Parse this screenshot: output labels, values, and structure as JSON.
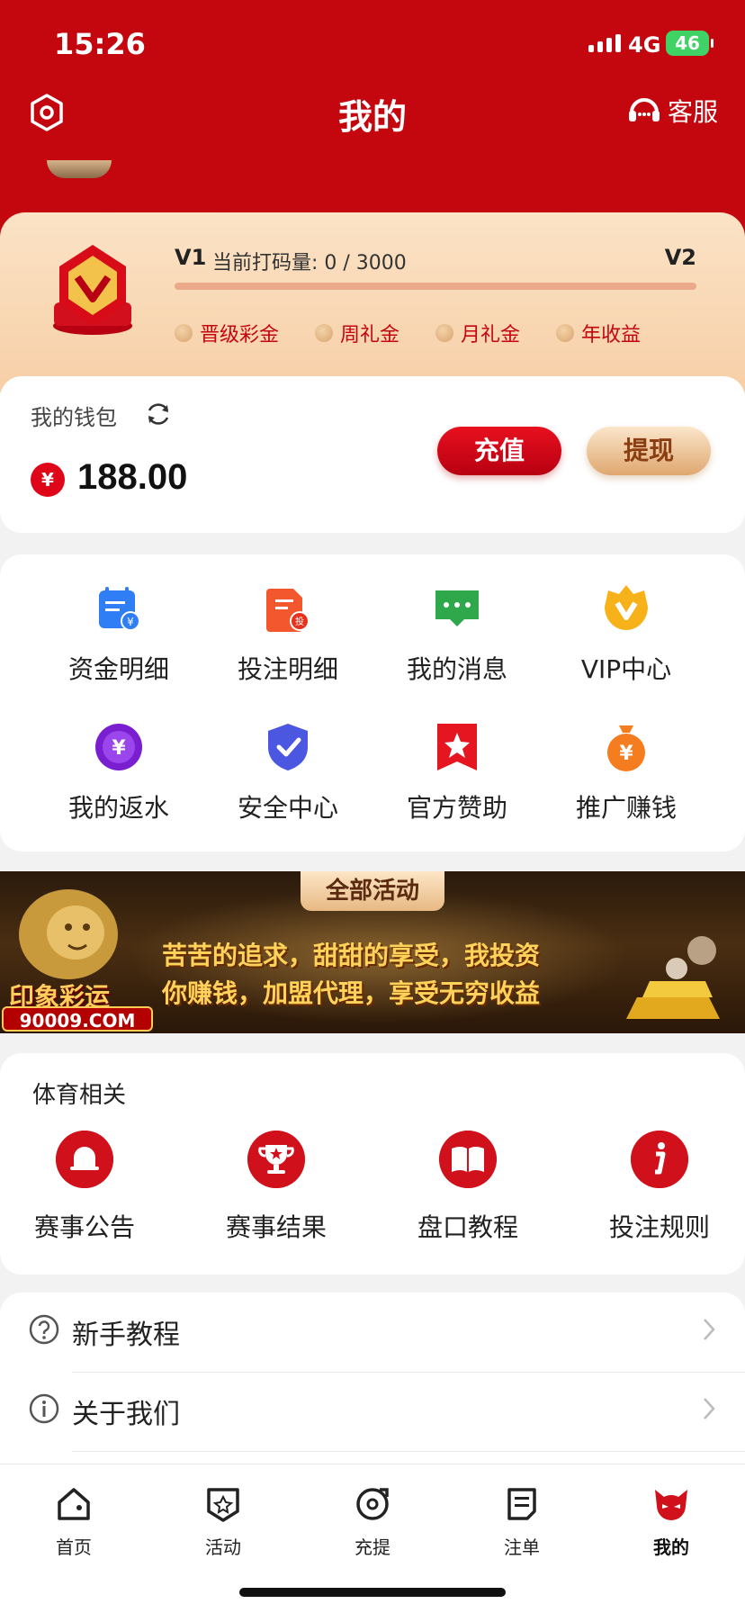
{
  "status": {
    "time": "15:26",
    "network": "4G",
    "battery": "46"
  },
  "header": {
    "title": "我的",
    "service_label": "客服"
  },
  "vip": {
    "current_level": "V1",
    "progress_label": "当前打码量: 0 / 3000",
    "progress_value": 0,
    "progress_target": 3000,
    "next_level": "V2",
    "perks": [
      "晋级彩金",
      "周礼金",
      "月礼金",
      "年收益"
    ]
  },
  "wallet": {
    "label": "我的钱包",
    "currency_symbol": "¥",
    "balance": "188.00",
    "deposit_label": "充值",
    "withdraw_label": "提现"
  },
  "menu": {
    "items": [
      {
        "label": "资金明细",
        "icon": "fund-detail-icon"
      },
      {
        "label": "投注明细",
        "icon": "bet-detail-icon"
      },
      {
        "label": "我的消息",
        "icon": "message-icon"
      },
      {
        "label": "VIP中心",
        "icon": "vip-crown-icon"
      },
      {
        "label": "我的返水",
        "icon": "rebate-icon"
      },
      {
        "label": "安全中心",
        "icon": "shield-check-icon"
      },
      {
        "label": "官方赞助",
        "icon": "star-ribbon-icon"
      },
      {
        "label": "推广赚钱",
        "icon": "promo-money-icon"
      }
    ]
  },
  "banner": {
    "tag": "全部活动",
    "line1": "苦苦的追求，甜甜的享受，我投资",
    "line2": "你赚钱，加盟代理，享受无穷收益",
    "brand": "印象彩运",
    "site": "90009.COM"
  },
  "sports": {
    "title": "体育相关",
    "items": [
      {
        "label": "赛事公告",
        "icon": "bell-icon"
      },
      {
        "label": "赛事结果",
        "icon": "trophy-icon"
      },
      {
        "label": "盘口教程",
        "icon": "book-icon"
      },
      {
        "label": "投注规则",
        "icon": "info-icon"
      }
    ]
  },
  "list": {
    "items": [
      {
        "label": "新手教程",
        "icon": "question-icon"
      },
      {
        "label": "关于我们",
        "icon": "info-circle-icon"
      }
    ]
  },
  "tabbar": {
    "items": [
      {
        "label": "首页",
        "icon": "home-icon"
      },
      {
        "label": "活动",
        "icon": "activity-icon"
      },
      {
        "label": "充提",
        "icon": "deposit-icon"
      },
      {
        "label": "注单",
        "icon": "order-icon"
      },
      {
        "label": "我的",
        "icon": "profile-icon"
      }
    ],
    "active": "我的"
  },
  "colors": {
    "brand_red": "#c4060f",
    "gold": "#e0a86f",
    "vip_bg": "#fbe3c6"
  }
}
